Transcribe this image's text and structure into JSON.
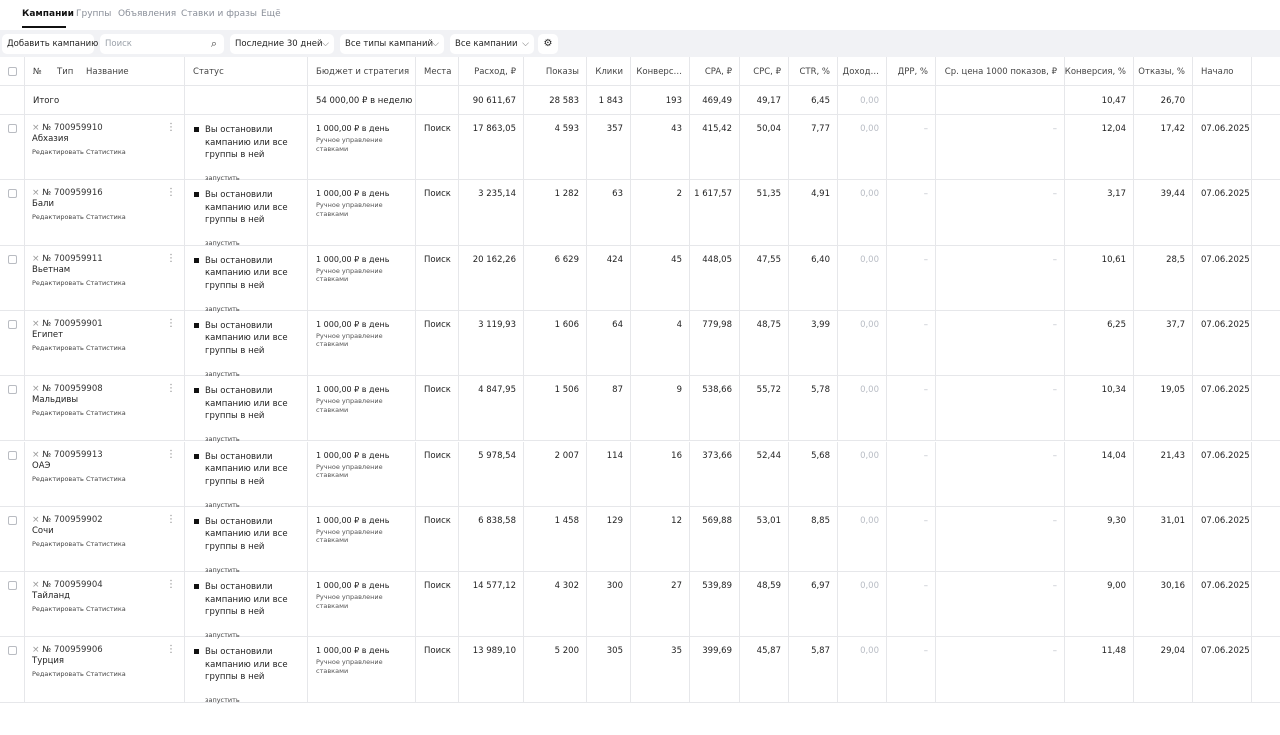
{
  "tabs": [
    {
      "label": "Кампании",
      "active": true
    },
    {
      "label": "Группы",
      "active": false
    },
    {
      "label": "Объявления",
      "active": false
    },
    {
      "label": "Ставки и фразы",
      "active": false
    },
    {
      "label": "Ещё",
      "active": false
    }
  ],
  "toolbar": {
    "add_campaign": "Добавить кампанию",
    "search_placeholder": "Поиск",
    "period": "Последние 30 дней",
    "campaign_types": "Все типы кампаний",
    "campaigns_filter": "Все кампании"
  },
  "columns": {
    "no": "№",
    "type": "Тип",
    "name": "Название",
    "status": "Статус",
    "budget": "Бюджет и стратегия",
    "places": "Места",
    "spend": "Расход, ₽",
    "impressions": "Показы",
    "clicks": "Клики",
    "conversions": "Конверс…",
    "cpa": "CPA, ₽",
    "cpc": "CPC, ₽",
    "ctr": "CTR, %",
    "income": "Доход…",
    "drr": "ДРР, %",
    "cpm": "Ср. цена 1000 показов, ₽",
    "conv_rate": "Конверсия, %",
    "bounces": "Отказы, %",
    "start": "Начало"
  },
  "totals": {
    "label": "Итого",
    "budget": "54 000,00 ₽ в неделю",
    "spend": "90 611,67",
    "impressions": "28 583",
    "clicks": "1 843",
    "conversions": "193",
    "cpa": "469,49",
    "cpc": "49,17",
    "ctr": "6,45",
    "income": "0,00",
    "conv_rate": "10,47",
    "bounces": "26,70"
  },
  "row_common": {
    "cross": "×",
    "edit_link": "Редактировать",
    "stats_link": "Статистика",
    "menu": "⋮",
    "status_text": "Вы остановили кампанию или все группы в ней",
    "status_action": "запустить",
    "budget": "1 000,00 ₽ в день",
    "strategy": "Ручное управление ставками",
    "place": "Поиск",
    "income": "0,00",
    "drr": "–",
    "cpm": "–",
    "start": "07.06.2025"
  },
  "campaigns": [
    {
      "id": "№ 700959910",
      "name": "Абхазия",
      "spend": "17 863,05",
      "impressions": "4 593",
      "clicks": "357",
      "conversions": "43",
      "cpa": "415,42",
      "cpc": "50,04",
      "ctr": "7,77",
      "conv_rate": "12,04",
      "bounces": "17,42"
    },
    {
      "id": "№ 700959916",
      "name": "Бали",
      "spend": "3 235,14",
      "impressions": "1 282",
      "clicks": "63",
      "conversions": "2",
      "cpa": "1 617,57",
      "cpc": "51,35",
      "ctr": "4,91",
      "conv_rate": "3,17",
      "bounces": "39,44"
    },
    {
      "id": "№ 700959911",
      "name": "Вьетнам",
      "spend": "20 162,26",
      "impressions": "6 629",
      "clicks": "424",
      "conversions": "45",
      "cpa": "448,05",
      "cpc": "47,55",
      "ctr": "6,40",
      "conv_rate": "10,61",
      "bounces": "28,5"
    },
    {
      "id": "№ 700959901",
      "name": "Египет",
      "spend": "3 119,93",
      "impressions": "1 606",
      "clicks": "64",
      "conversions": "4",
      "cpa": "779,98",
      "cpc": "48,75",
      "ctr": "3,99",
      "conv_rate": "6,25",
      "bounces": "37,7"
    },
    {
      "id": "№ 700959908",
      "name": "Мальдивы",
      "spend": "4 847,95",
      "impressions": "1 506",
      "clicks": "87",
      "conversions": "9",
      "cpa": "538,66",
      "cpc": "55,72",
      "ctr": "5,78",
      "conv_rate": "10,34",
      "bounces": "19,05"
    },
    {
      "id": "№ 700959913",
      "name": "ОАЭ",
      "spend": "5 978,54",
      "impressions": "2 007",
      "clicks": "114",
      "conversions": "16",
      "cpa": "373,66",
      "cpc": "52,44",
      "ctr": "5,68",
      "conv_rate": "14,04",
      "bounces": "21,43"
    },
    {
      "id": "№ 700959902",
      "name": "Сочи",
      "spend": "6 838,58",
      "impressions": "1 458",
      "clicks": "129",
      "conversions": "12",
      "cpa": "569,88",
      "cpc": "53,01",
      "ctr": "8,85",
      "conv_rate": "9,30",
      "bounces": "31,01"
    },
    {
      "id": "№ 700959904",
      "name": "Тайланд",
      "spend": "14 577,12",
      "impressions": "4 302",
      "clicks": "300",
      "conversions": "27",
      "cpa": "539,89",
      "cpc": "48,59",
      "ctr": "6,97",
      "conv_rate": "9,00",
      "bounces": "30,16"
    },
    {
      "id": "№ 700959906",
      "name": "Турция",
      "spend": "13 989,10",
      "impressions": "5 200",
      "clicks": "305",
      "conversions": "35",
      "cpa": "399,69",
      "cpc": "45,87",
      "ctr": "5,87",
      "conv_rate": "11,48",
      "bounces": "29,04"
    }
  ]
}
